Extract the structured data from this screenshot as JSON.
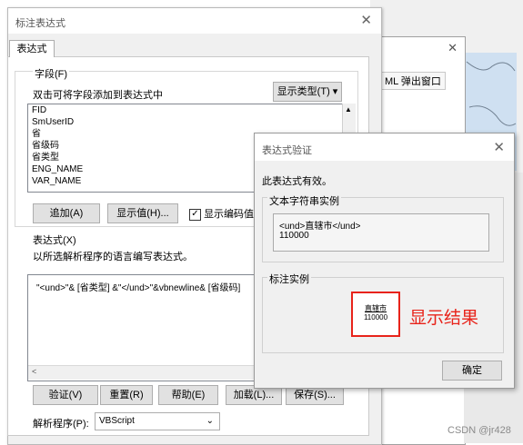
{
  "background_window": {
    "popup_tab": "ML 弹出窗口",
    "watermark": "CSDN @jr428"
  },
  "main_dialog": {
    "title": "标注表达式",
    "tab": "表达式",
    "fields": {
      "group_label": "字段(F)",
      "instruction": "双击可将字段添加到表达式中",
      "show_type_button": "显示类型(T)",
      "items": [
        "FID",
        "SmUserID",
        "省",
        "省级码",
        "省类型",
        "ENG_NAME",
        "VAR_NAME"
      ],
      "add_button": "追加(A)",
      "show_values_button": "显示值(H)...",
      "checkbox_label": "显示编码值",
      "checkbox_checked": true
    },
    "expression": {
      "group_label": "表达式(X)",
      "instruction": "以所选解析程序的语言编写表达式。",
      "value": "\"<und>\"& [省类型] &\"</und>\"&vbnewline& [省级码]"
    },
    "buttons": {
      "verify": "验证(V)",
      "reset": "重置(R)",
      "help": "帮助(E)",
      "load": "加载(L)...",
      "save": "保存(S)..."
    },
    "parser": {
      "label": "解析程序(P):",
      "value": "VBScript"
    }
  },
  "verify_dialog": {
    "title": "表达式验证",
    "message": "此表达式有效。",
    "text_sample_label": "文本字符串实例",
    "text_sample_line1": "<und>直辖市</und>",
    "text_sample_line2": "110000",
    "label_sample_label": "标注实例",
    "label_line1": "直辖市",
    "label_line2": "110000",
    "ok_button": "确定"
  },
  "annotation": {
    "result_text": "显示结果",
    "color": "#e8231a"
  }
}
